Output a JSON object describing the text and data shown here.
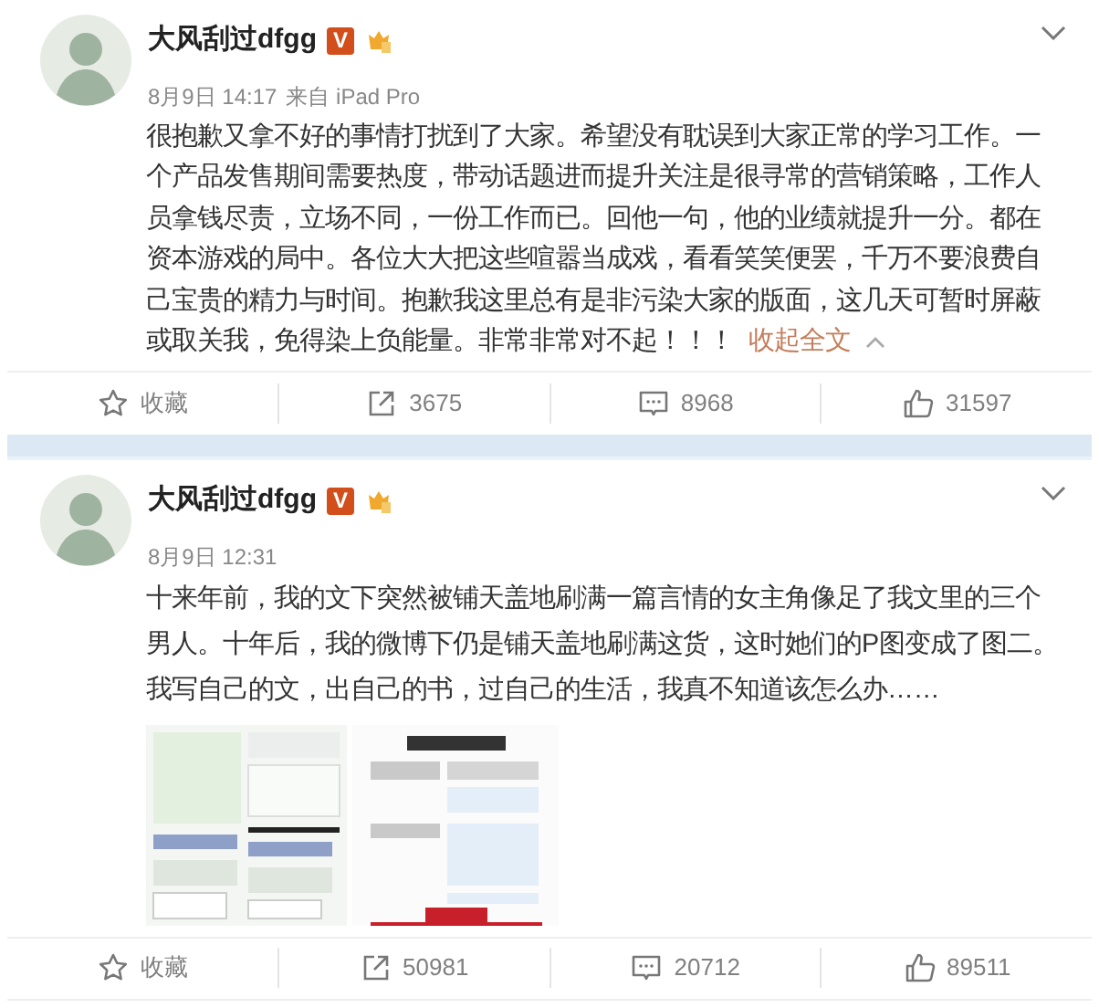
{
  "posts": [
    {
      "author": "大风刮过dfgg",
      "badge": "V",
      "time": "8月9日 14:17",
      "source": "来自 iPad Pro",
      "text": "很抱歉又拿不好的事情打扰到了大家。希望没有耽误到大家正常的学习工作。一个产品发售期间需要热度，带动话题进而提升关注是很寻常的营销策略，工作人员拿钱尽责，立场不同，一份工作而已。回他一句，他的业绩就提升一分。都在资本游戏的局中。各位大大把这些喧嚣当成戏，看看笑笑便罢，千万不要浪费自己宝贵的精力与时间。抱歉我这里总有是非污染大家的版面，这几天可暂时屏蔽或取关我，免得染上负能量。非常非常对不起！！！",
      "collapse_link": "收起全文",
      "actions": [
        {
          "kind": "favorite",
          "label": "收藏"
        },
        {
          "kind": "repost",
          "label": "3675"
        },
        {
          "kind": "comment",
          "label": "8968"
        },
        {
          "kind": "like",
          "label": "31597"
        }
      ]
    },
    {
      "author": "大风刮过dfgg",
      "badge": "V",
      "time": "8月9日 12:31",
      "text": "十来年前，我的文下突然被铺天盖地刷满一篇言情的女主角像足了我文里的三个男人。十年后，我的微博下仍是铺天盖地刷满这货，这时她们的P图变成了图二。我写自己的文，出自己的书，过自己的生活，我真不知道该怎么办……",
      "actions": [
        {
          "kind": "favorite",
          "label": "收藏"
        },
        {
          "kind": "repost",
          "label": "50981"
        },
        {
          "kind": "comment",
          "label": "20712"
        },
        {
          "kind": "like",
          "label": "89511"
        }
      ]
    }
  ]
}
